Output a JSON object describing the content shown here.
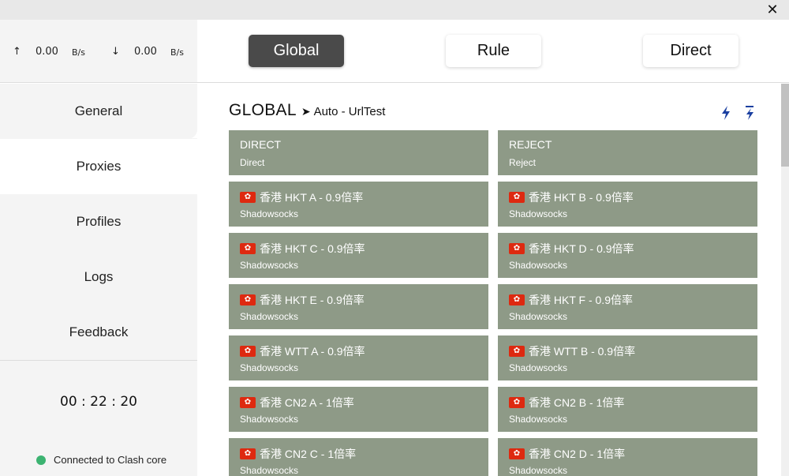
{
  "window": {
    "close_label": "✕"
  },
  "traffic": {
    "up_arrow": "↑",
    "up_value": "0.00",
    "up_unit": "B/s",
    "down_arrow": "↓",
    "down_value": "0.00",
    "down_unit": "B/s"
  },
  "sidebar": {
    "items": [
      {
        "label": "General"
      },
      {
        "label": "Proxies"
      },
      {
        "label": "Profiles"
      },
      {
        "label": "Logs"
      },
      {
        "label": "Feedback"
      }
    ],
    "active": "Proxies",
    "timer": "00 : 22 : 20",
    "status": "Connected to Clash core",
    "status_color": "#3cb371"
  },
  "modes": {
    "global": "Global",
    "rule": "Rule",
    "direct": "Direct",
    "active": "Global"
  },
  "group": {
    "name": "GLOBAL",
    "arrow": "➤",
    "now": "Auto - UrlTest",
    "icons": [
      "latency-test-icon",
      "latency-test-all-icon"
    ],
    "accent": "#1a3fa0"
  },
  "proxies": [
    {
      "name": "DIRECT",
      "type": "Direct",
      "flag": false
    },
    {
      "name": "REJECT",
      "type": "Reject",
      "flag": false
    },
    {
      "name": "香港 HKT A - 0.9倍率",
      "type": "Shadowsocks",
      "flag": true
    },
    {
      "name": "香港 HKT B - 0.9倍率",
      "type": "Shadowsocks",
      "flag": true
    },
    {
      "name": "香港 HKT C - 0.9倍率",
      "type": "Shadowsocks",
      "flag": true
    },
    {
      "name": "香港 HKT D - 0.9倍率",
      "type": "Shadowsocks",
      "flag": true
    },
    {
      "name": "香港 HKT E - 0.9倍率",
      "type": "Shadowsocks",
      "flag": true
    },
    {
      "name": "香港 HKT F - 0.9倍率",
      "type": "Shadowsocks",
      "flag": true
    },
    {
      "name": "香港 WTT A - 0.9倍率",
      "type": "Shadowsocks",
      "flag": true
    },
    {
      "name": "香港 WTT B - 0.9倍率",
      "type": "Shadowsocks",
      "flag": true
    },
    {
      "name": "香港 CN2 A - 1倍率",
      "type": "Shadowsocks",
      "flag": true
    },
    {
      "name": "香港 CN2 B - 1倍率",
      "type": "Shadowsocks",
      "flag": true
    },
    {
      "name": "香港 CN2 C - 1倍率",
      "type": "Shadowsocks",
      "flag": true
    },
    {
      "name": "香港 CN2 D - 1倍率",
      "type": "Shadowsocks",
      "flag": true
    }
  ],
  "colors": {
    "card_bg": "#8e9a87",
    "mode_active_bg": "#4a4a4a",
    "flag_red": "#de2910"
  }
}
